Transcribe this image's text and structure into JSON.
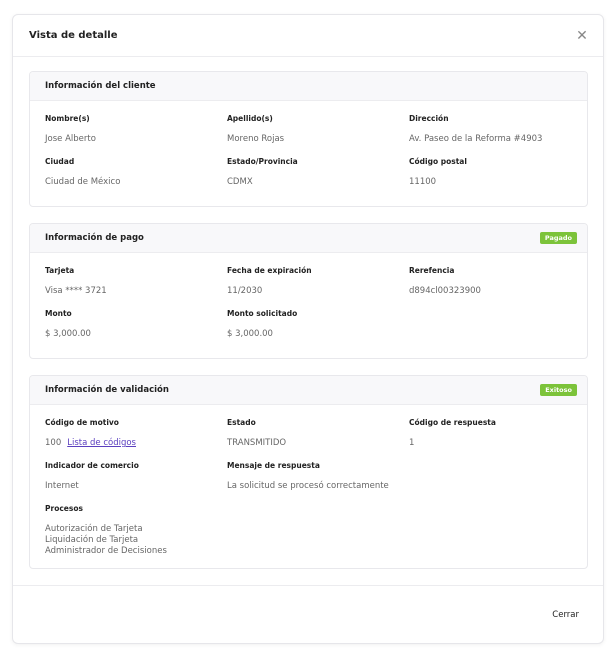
{
  "modal": {
    "title": "Vista de detalle",
    "close_icon": "close-icon",
    "footer_button": "Cerrar"
  },
  "client": {
    "title": "Información del cliente",
    "fields": [
      {
        "label": "Nombre(s)",
        "value": "Jose Alberto"
      },
      {
        "label": "Apellido(s)",
        "value": "Moreno Rojas"
      },
      {
        "label": "Dirección",
        "value": "Av. Paseo de la Reforma #4903"
      },
      {
        "label": "Ciudad",
        "value": "Ciudad de México"
      },
      {
        "label": "Estado/Provincia",
        "value": "CDMX"
      },
      {
        "label": "Código postal",
        "value": "11100"
      }
    ]
  },
  "payment": {
    "title": "Información de pago",
    "badge": "Pagado",
    "badge_color": "#7cc33a",
    "fields": [
      {
        "label": "Tarjeta",
        "value": "Visa **** 3721"
      },
      {
        "label": "Fecha de expiración",
        "value": "11/2030"
      },
      {
        "label": "Rerefencia",
        "value": "d894cl00323900"
      },
      {
        "label": "Monto",
        "value": "$ 3,000.00"
      },
      {
        "label": "Monto solicitado",
        "value": "$ 3,000.00"
      }
    ]
  },
  "validation": {
    "title": "Información de validación",
    "badge": "Exitoso",
    "badge_color": "#7cc33a",
    "reason_code_label": "Código de motivo",
    "reason_code_value": "100",
    "reason_code_link": "Lista de códigos",
    "status_label": "Estado",
    "status_value": "TRANSMITIDO",
    "response_code_label": "Código de respuesta",
    "response_code_value": "1",
    "merchant_label": "Indicador de comercio",
    "merchant_value": "Internet",
    "message_label": "Mensaje de respuesta",
    "message_value": "La solicitud se procesó correctamente",
    "processes_label": "Procesos",
    "processes": [
      "Autorización de Tarjeta",
      "Liquidación de Tarjeta",
      "Administrador de Decisiones"
    ]
  }
}
